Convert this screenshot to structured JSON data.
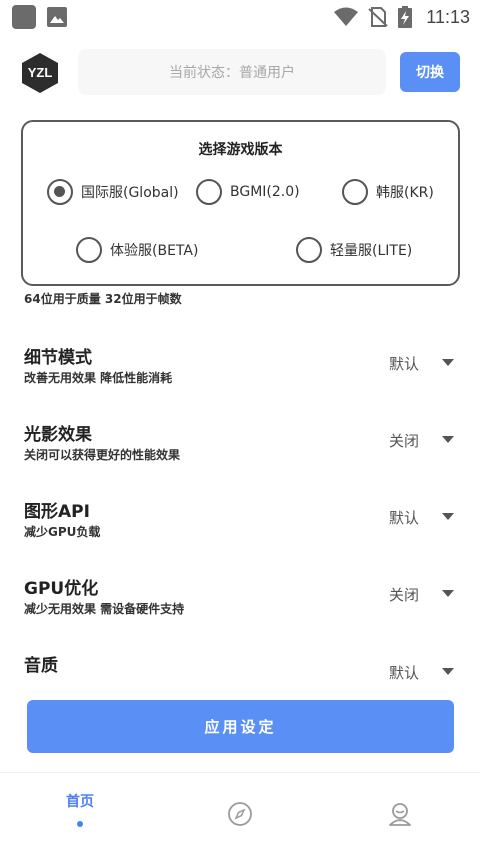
{
  "status_bar": {
    "time": "11:13"
  },
  "header": {
    "logo_text": "YZL",
    "status_text": "当前状态：普通用户",
    "switch_label": "切换"
  },
  "dialog": {
    "title": "选择游戏版本",
    "options": [
      {
        "label": "国际服(Global)",
        "checked": true
      },
      {
        "label": "BGMI(2.0)",
        "checked": false
      },
      {
        "label": "韩服(KR)",
        "checked": false
      },
      {
        "label": "体验服(BETA)",
        "checked": false
      },
      {
        "label": "轻量服(LITE)",
        "checked": false
      }
    ]
  },
  "settings": {
    "cut_text": "64位用于质量 32位用于帧数",
    "rows": [
      {
        "title": "细节模式",
        "subtitle": "改善无用效果 降低性能消耗",
        "value": "默认"
      },
      {
        "title": "光影效果",
        "subtitle": "关闭可以获得更好的性能效果",
        "value": "关闭"
      },
      {
        "title": "图形API",
        "subtitle": "减少GPU负载",
        "value": "默认"
      },
      {
        "title": "GPU优化",
        "subtitle": "减少无用效果 需设备硬件支持",
        "value": "关闭"
      },
      {
        "title": "音质",
        "subtitle": "",
        "value": "默认"
      }
    ]
  },
  "apply_label": "应用设定",
  "bottom_nav": {
    "home_label": "首页",
    "items": [
      {
        "icon": "home",
        "active": true
      },
      {
        "icon": "compass-icon",
        "active": false
      },
      {
        "icon": "user-icon",
        "active": false
      }
    ]
  },
  "colors": {
    "accent": "#5a8ff5"
  }
}
